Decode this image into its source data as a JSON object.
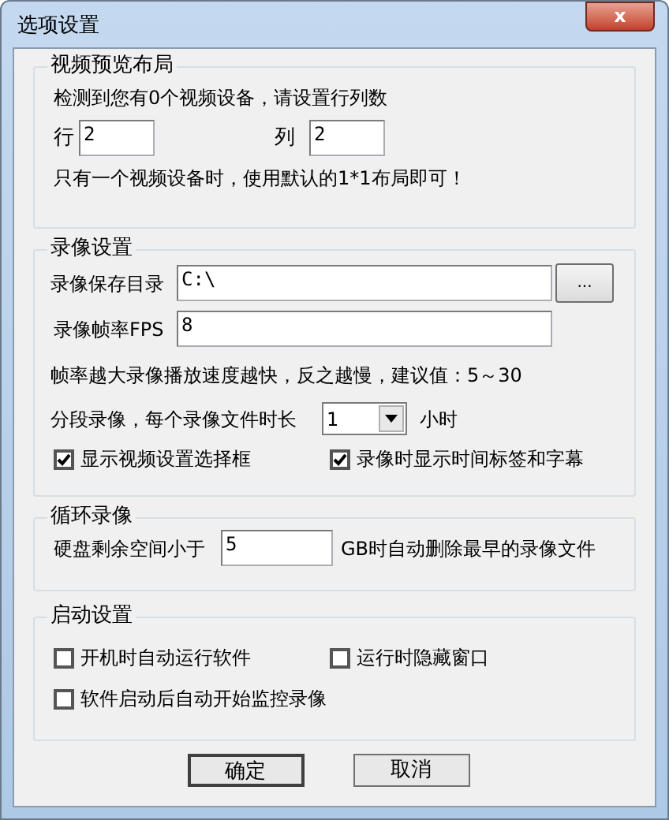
{
  "window": {
    "title": "选项设置",
    "close": "x"
  },
  "layout_group": {
    "legend": "视频预览布局",
    "info": "检测到您有0个视频设备，请设置行列数",
    "rows_label": "行",
    "rows_value": "2",
    "cols_label": "列",
    "cols_value": "2",
    "note": "只有一个视频设备时，使用默认的1*1布局即可！"
  },
  "record_group": {
    "legend": "录像设置",
    "dir_label": "录像保存目录",
    "dir_value": "C:\\",
    "browse": "...",
    "fps_label": "录像帧率FPS",
    "fps_value": "8",
    "fps_hint": "帧率越大录像播放速度越快，反之越慢，建议值：5～30",
    "segment_label": "分段录像，每个录像文件时长",
    "segment_value": "1",
    "segment_unit": "小时",
    "checkboxes": [
      {
        "label": "显示视频设置选择框",
        "checked": true
      },
      {
        "label": "录像时显示时间标签和字幕",
        "checked": true
      }
    ]
  },
  "loop_group": {
    "legend": "循环录像",
    "prefix": "硬盘剩余空间小于",
    "value": "5",
    "suffix": "GB时自动删除最早的录像文件"
  },
  "startup_group": {
    "legend": "启动设置",
    "checkboxes": [
      {
        "label": "开机时自动运行软件",
        "checked": false
      },
      {
        "label": "运行时隐藏窗口",
        "checked": false
      },
      {
        "label": "软件启动后自动开始监控录像",
        "checked": false
      }
    ]
  },
  "buttons": [
    {
      "label": "确定",
      "default": true
    },
    {
      "label": "取消",
      "default": false
    }
  ]
}
